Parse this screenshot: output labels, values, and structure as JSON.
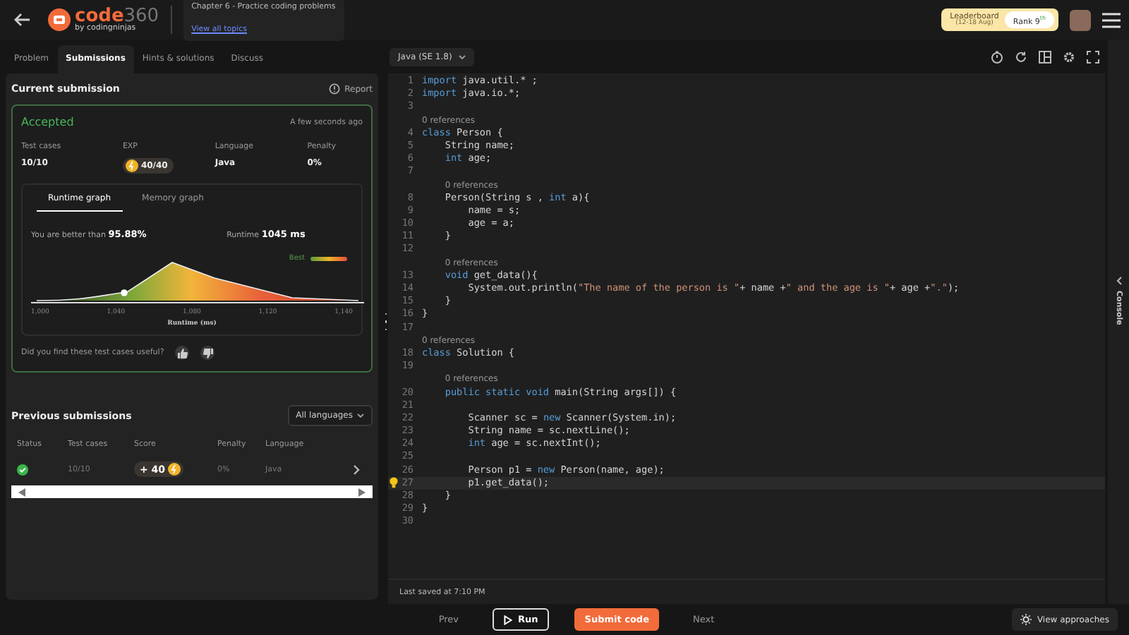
{
  "header": {
    "logo": {
      "name": "code",
      "number": "360",
      "byline": "by codingninjas"
    },
    "chapter": "Chapter 6 - Practice coding problems",
    "topics_link": "View all topics",
    "leaderboard": {
      "label": "Leaderboard",
      "dates": "(12-18 Aug)",
      "rank": "Rank 9$^{th}$"
    }
  },
  "tabs": [
    {
      "label": "Problem",
      "selected": false
    },
    {
      "label": "Submissions",
      "selected": true
    },
    {
      "label": "Hints & solutions",
      "selected": false
    },
    {
      "label": "Discuss",
      "selected": false
    }
  ],
  "current_submission": {
    "title": "Current submission",
    "report": "Report",
    "status": "Accepted",
    "time": "A few seconds ago",
    "stats": [
      {
        "label": "Test cases",
        "value": "10/10",
        "kind": "text"
      },
      {
        "label": "EXP",
        "value": "40/40",
        "kind": "coin"
      },
      {
        "label": "Language",
        "value": "Java",
        "kind": "text"
      },
      {
        "label": "Penalty",
        "value": "0%",
        "kind": "text"
      }
    ],
    "graph_tabs": [
      {
        "label": "Runtime graph",
        "selected": true
      },
      {
        "label": "Memory graph",
        "selected": false
      }
    ],
    "better_than": "You are better than **95.88%**",
    "runtime": "Runtime **1045 ms**",
    "legend": "Best",
    "x_tick_labels": [
      "1,000",
      "1,040",
      "1,080",
      "1,120",
      "1,140"
    ],
    "axis_label": "Runtime (ms)",
    "feedback": "Did you find these test cases useful?"
  },
  "previous_submissions": {
    "title": "Previous submissions",
    "filter": "All languages",
    "columns": [
      "Status",
      "Test cases",
      "Score",
      "Penalty",
      "Language"
    ],
    "rows": [
      {
        "passed": true,
        "test_cases": "10/10",
        "score": "+ 40",
        "penalty": "0%",
        "language": "Java"
      }
    ]
  },
  "editor": {
    "language": "Java (SE 1.8)",
    "last_saved": "Last saved at 7:10 PM",
    "console": "Console",
    "lines": [
      {
        "number": "1",
        "active": false,
        "segments": [
          {
            "kind": "keyword",
            "text": "import"
          },
          {
            "kind": "plain",
            "text": " java.util.* ;"
          }
        ]
      },
      {
        "number": "2",
        "active": false,
        "segments": [
          {
            "kind": "keyword",
            "text": "import"
          },
          {
            "kind": "plain",
            "text": " java.io.*;"
          }
        ]
      },
      {
        "number": "3",
        "active": false
      },
      {
        "number": "4",
        "active": false,
        "refs": "0 references",
        "segments": [
          {
            "kind": "keyword",
            "text": "class"
          },
          {
            "kind": "plain",
            "text": " Person {"
          }
        ]
      },
      {
        "number": "5",
        "active": false,
        "segments": [
          {
            "kind": "plain",
            "text": "    String name;"
          }
        ]
      },
      {
        "number": "6",
        "active": false,
        "segments": [
          {
            "kind": "keyword",
            "text": "    int"
          },
          {
            "kind": "plain",
            "text": " age;"
          }
        ]
      },
      {
        "number": "7",
        "active": false
      },
      {
        "number": "8",
        "active": false,
        "refs": "0 references",
        "segments": [
          {
            "kind": "plain",
            "text": "    Person(String s , "
          },
          {
            "kind": "keyword",
            "text": "int"
          },
          {
            "kind": "plain",
            "text": " a){"
          }
        ]
      },
      {
        "number": "9",
        "active": false,
        "segments": [
          {
            "kind": "plain",
            "text": "        name = s;"
          }
        ]
      },
      {
        "number": "10",
        "active": false,
        "segments": [
          {
            "kind": "plain",
            "text": "        age = a;"
          }
        ]
      },
      {
        "number": "11",
        "active": false,
        "segments": [
          {
            "kind": "plain",
            "text": "    }"
          }
        ]
      },
      {
        "number": "12",
        "active": false
      },
      {
        "number": "13",
        "active": false,
        "refs": "0 references",
        "segments": [
          {
            "kind": "keyword",
            "text": "    void"
          },
          {
            "kind": "plain",
            "text": " get_data(){"
          }
        ]
      },
      {
        "number": "14",
        "active": false,
        "segments": [
          {
            "kind": "plain",
            "text": "        System.out.println("
          },
          {
            "kind": "string",
            "text": "\"The name of the person is \""
          },
          {
            "kind": "plain",
            "text": "+ name +"
          },
          {
            "kind": "string",
            "text": "\" and the age is \""
          },
          {
            "kind": "plain",
            "text": "+ age +"
          },
          {
            "kind": "string",
            "text": "\".\""
          },
          {
            "kind": "plain",
            "text": ");"
          }
        ]
      },
      {
        "number": "15",
        "active": false,
        "segments": [
          {
            "kind": "plain",
            "text": "    }"
          }
        ]
      },
      {
        "number": "16",
        "active": false,
        "segments": [
          {
            "kind": "plain",
            "text": "}"
          }
        ]
      },
      {
        "number": "17",
        "active": false
      },
      {
        "number": "18",
        "active": false,
        "refs": "0 references",
        "segments": [
          {
            "kind": "keyword",
            "text": "class"
          },
          {
            "kind": "plain",
            "text": " Solution {"
          }
        ]
      },
      {
        "number": "19",
        "active": false
      },
      {
        "number": "20",
        "active": false,
        "refs": "0 references",
        "segments": [
          {
            "kind": "keyword",
            "text": "    public static void"
          },
          {
            "kind": "plain",
            "text": " main(String args[]) {"
          }
        ]
      },
      {
        "number": "21",
        "active": false
      },
      {
        "number": "22",
        "active": false,
        "segments": [
          {
            "kind": "plain",
            "text": "        Scanner sc = "
          },
          {
            "kind": "keyword",
            "text": "new"
          },
          {
            "kind": "plain",
            "text": " Scanner(System.in);"
          }
        ]
      },
      {
        "number": "23",
        "active": false,
        "segments": [
          {
            "kind": "plain",
            "text": "        String name = sc.nextLine();"
          }
        ]
      },
      {
        "number": "24",
        "active": false,
        "segments": [
          {
            "kind": "keyword",
            "text": "        int"
          },
          {
            "kind": "plain",
            "text": " age = sc.nextInt();"
          }
        ]
      },
      {
        "number": "25",
        "active": false
      },
      {
        "number": "26",
        "active": false,
        "segments": [
          {
            "kind": "plain",
            "text": "        Person p1 = "
          },
          {
            "kind": "keyword",
            "text": "new"
          },
          {
            "kind": "plain",
            "text": " Person(name, age);"
          }
        ]
      },
      {
        "number": "27",
        "active": true,
        "segments": [
          {
            "kind": "plain",
            "text": "        p1.get_data();"
          }
        ]
      },
      {
        "number": "28",
        "active": false,
        "segments": [
          {
            "kind": "plain",
            "text": "    }"
          }
        ]
      },
      {
        "number": "29",
        "active": false,
        "segments": [
          {
            "kind": "plain",
            "text": "}"
          }
        ]
      },
      {
        "number": "30",
        "active": false
      }
    ]
  },
  "footer": {
    "prev": "Prev",
    "run": "Run",
    "submit": "Submit code",
    "next": "Next",
    "approaches": "View approaches"
  }
}
